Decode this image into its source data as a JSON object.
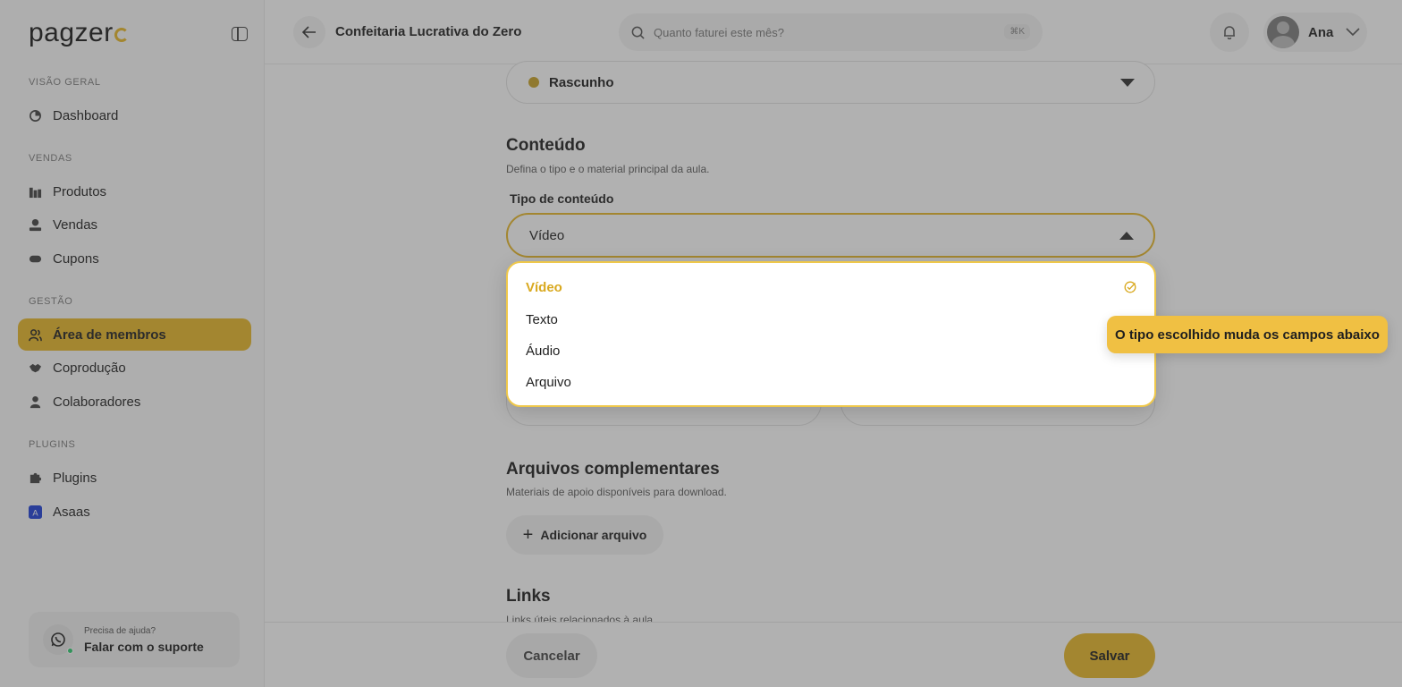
{
  "brand": {
    "logo_text": "pagzer",
    "accent": "#e8b828"
  },
  "sidebar": {
    "sections": [
      "Visão geral",
      "Vendas",
      "Gestão",
      "Plugins"
    ],
    "items": [
      {
        "label": "Dashboard",
        "icon": "dashboard-icon"
      },
      {
        "label": "Produtos",
        "icon": "products-icon"
      },
      {
        "label": "Vendas",
        "icon": "sales-icon"
      },
      {
        "label": "Cupons",
        "icon": "coupon-icon"
      },
      {
        "label": "Área de membros",
        "icon": "members-icon",
        "active": true
      },
      {
        "label": "Coprodução",
        "icon": "handshake-icon"
      },
      {
        "label": "Colaboradores",
        "icon": "user-icon"
      },
      {
        "label": "Plugins",
        "icon": "puzzle-icon"
      },
      {
        "label": "Asaas",
        "icon": "asaas-icon"
      }
    ],
    "help": {
      "small": "Precisa de ajuda?",
      "big": "Falar com o suporte"
    }
  },
  "topbar": {
    "title": "Confeitaria Lucrativa do Zero",
    "search_placeholder": "Quanto faturei este mês?",
    "shortcut": "⌘K",
    "user_name": "Ana"
  },
  "main": {
    "status_value": "Rascunho",
    "content": {
      "heading": "Conteúdo",
      "description": "Defina o tipo e o material principal da aula.",
      "type_label": "Tipo de conteúdo",
      "type_value": "Vídeo",
      "options": [
        "Vídeo",
        "Texto",
        "Áudio",
        "Arquivo"
      ],
      "selected_option": "Vídeo"
    },
    "files": {
      "heading": "Arquivos complementares",
      "description": "Materiais de apoio disponíveis para download.",
      "add_label": "Adicionar arquivo"
    },
    "links": {
      "heading": "Links",
      "description": "Links úteis relacionados à aula."
    }
  },
  "footer": {
    "cancel_label": "Cancelar",
    "save_label": "Salvar"
  },
  "tooltip": {
    "text": "O tipo escolhido muda os campos abaixo"
  }
}
